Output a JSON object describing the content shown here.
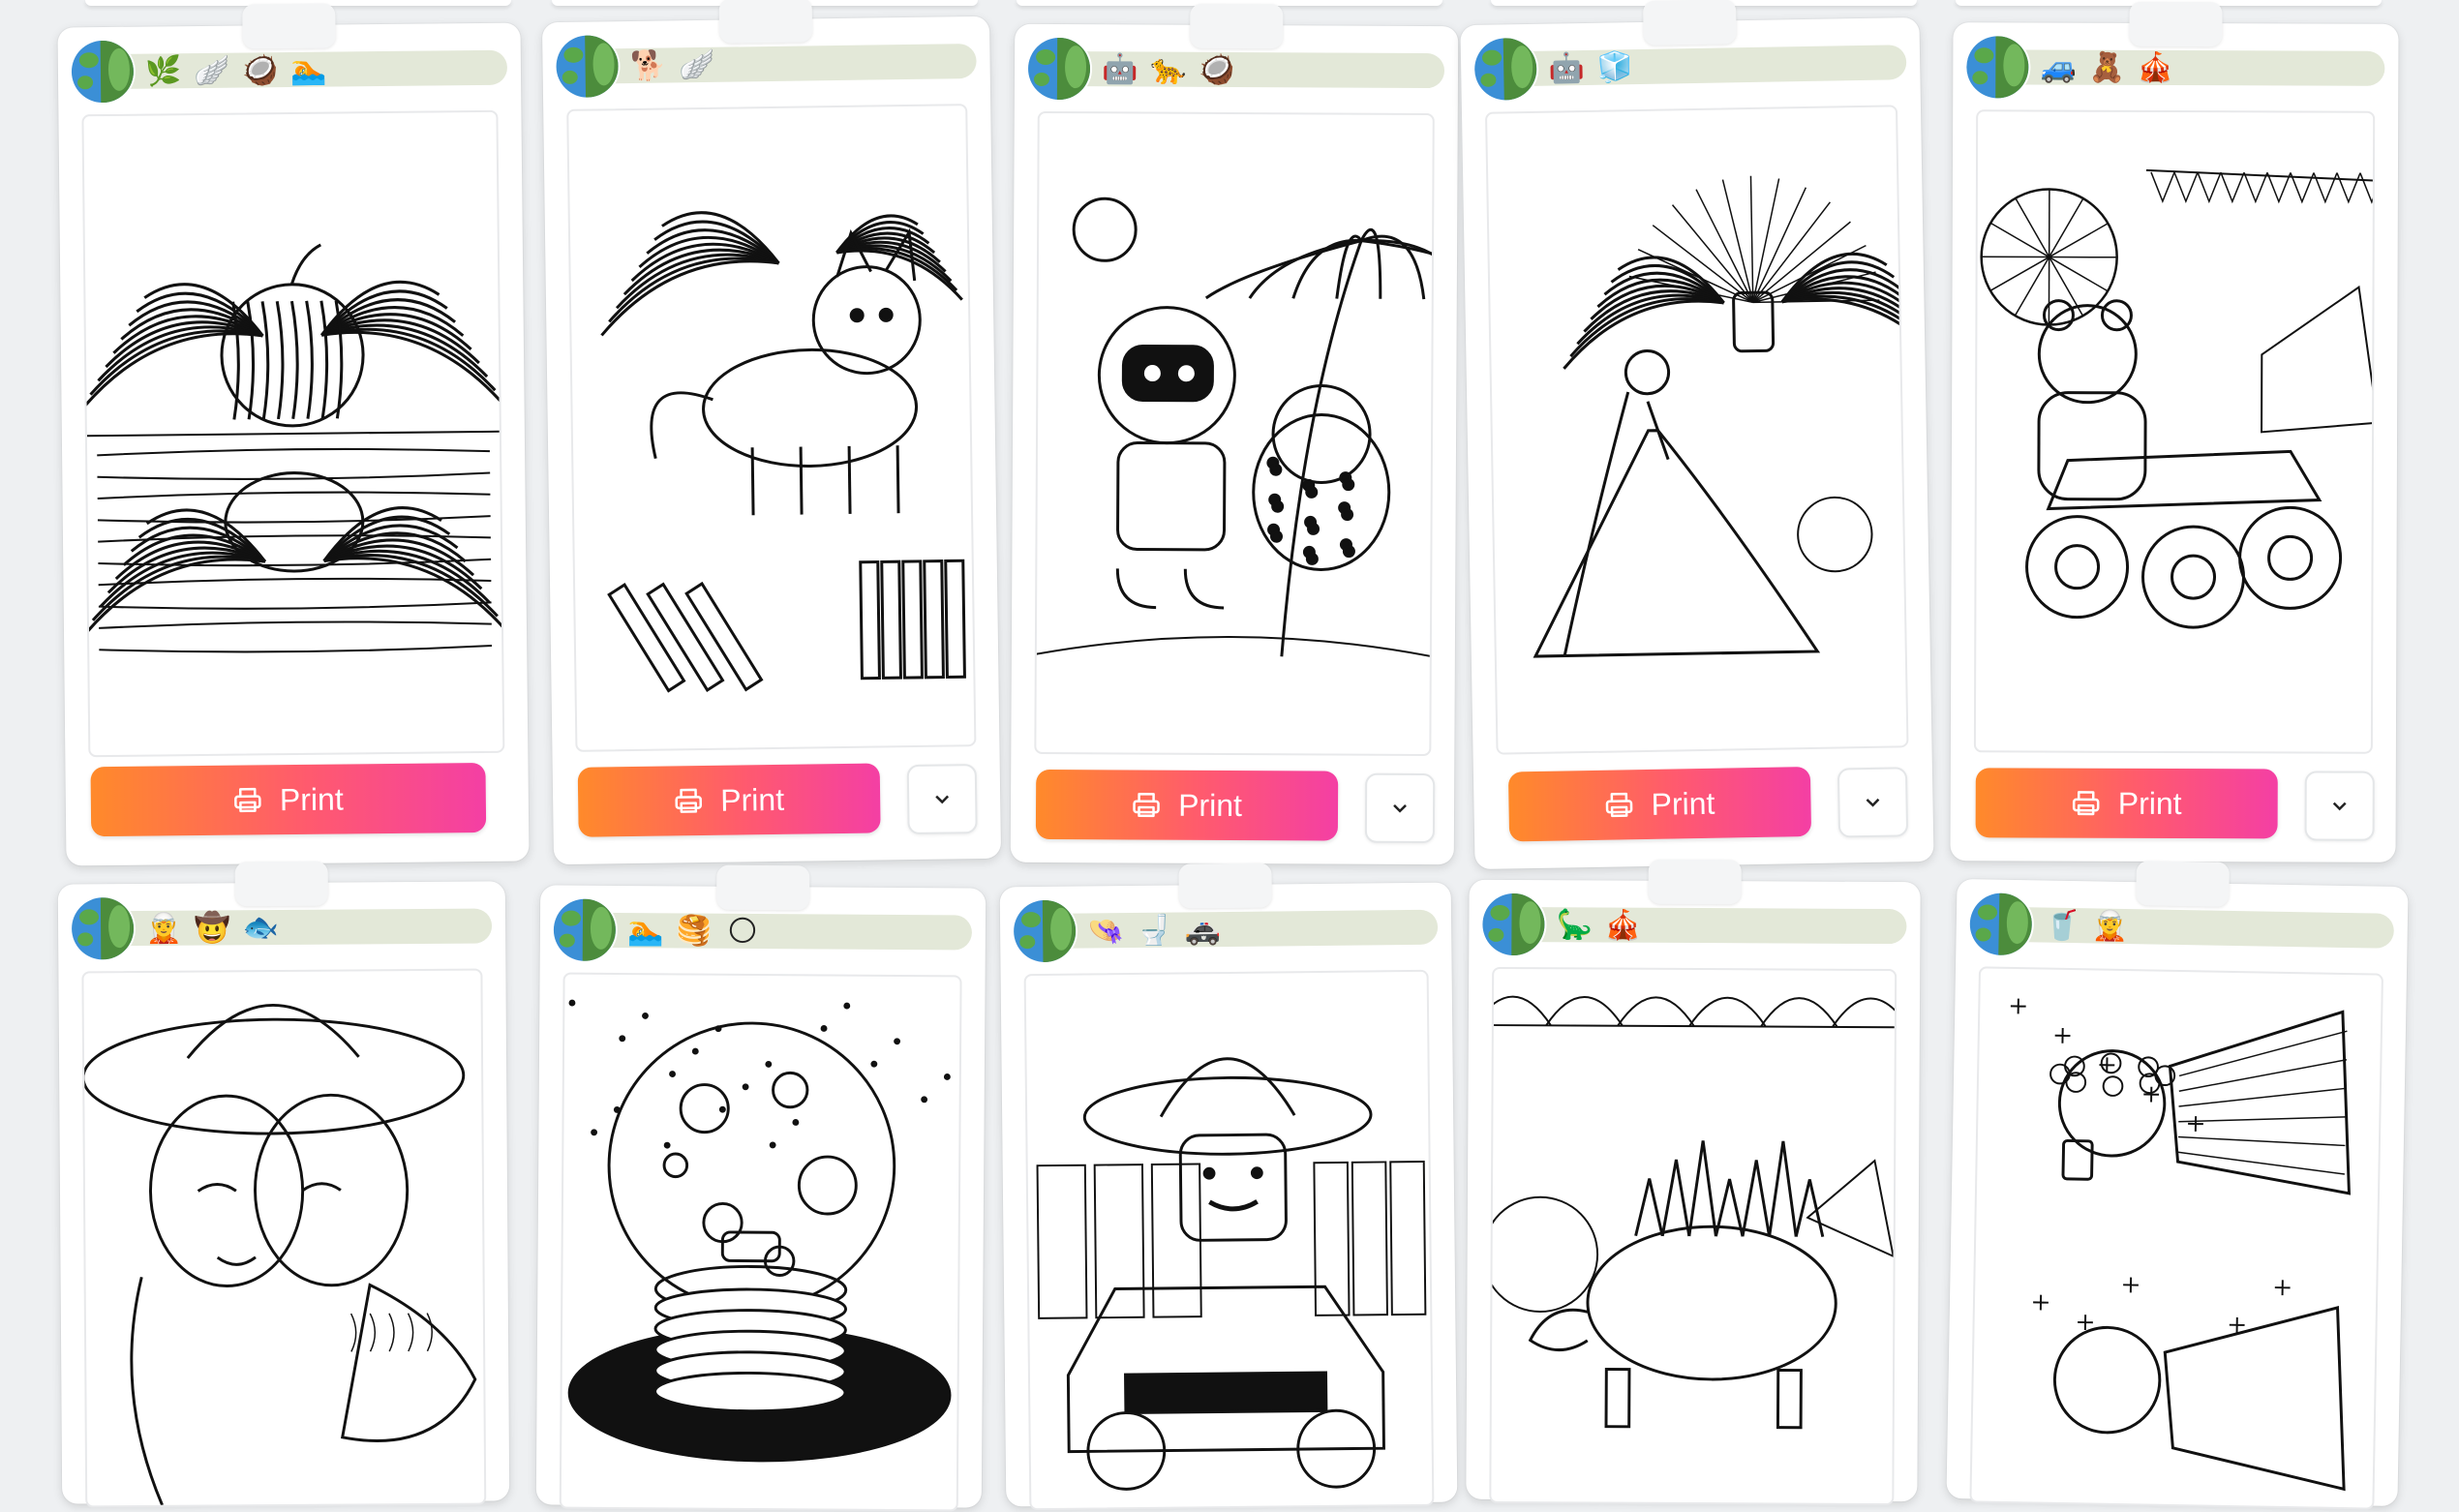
{
  "cards": [
    {
      "emojis": [
        "🌿",
        "🪽",
        "🥥",
        "🏊"
      ],
      "print_label": "Print",
      "has_dropdown": false,
      "art": "winged coconut reflecting on water"
    },
    {
      "emojis": [
        "🐕",
        "🪽"
      ],
      "print_label": "Print",
      "has_dropdown": true,
      "art": "winged puppy with crayons"
    },
    {
      "emojis": [
        "🤖",
        "🐆",
        "🥥"
      ],
      "print_label": "Print",
      "has_dropdown": true,
      "art": "robot and leopard under palm tree"
    },
    {
      "emojis": [
        "🤖",
        "🧊"
      ],
      "print_label": "Print",
      "has_dropdown": true,
      "art": "winged princess and robot"
    },
    {
      "emojis": [
        "🚙",
        "🧸",
        "🎪"
      ],
      "print_label": "Print",
      "has_dropdown": true,
      "art": "teddy bear monster truck carnival"
    },
    {
      "emojis": [
        "🧝",
        "🤠",
        "🐟"
      ],
      "print_label": "Print",
      "has_dropdown": false,
      "art": "cowboy portrait with fish"
    },
    {
      "emojis": [
        "🏊",
        "🥞",
        "🌕"
      ],
      "print_label": "Print",
      "has_dropdown": false,
      "art": "pancakes on moon"
    },
    {
      "emojis": [
        "👒",
        "🚽",
        "🚓"
      ],
      "print_label": "Print",
      "has_dropdown": false,
      "art": "sombrero character in police car"
    },
    {
      "emojis": [
        "🦕",
        "🎪"
      ],
      "print_label": "Print",
      "has_dropdown": false,
      "art": "stegosaurus at carnival"
    },
    {
      "emojis": [
        "🥤",
        "🧝"
      ],
      "print_label": "Print",
      "has_dropdown": false,
      "art": "flower girl with drink"
    }
  ],
  "colors": {
    "print_start": "#ff8a2a",
    "print_end": "#f43fa4",
    "header_bar": "#e3e8d8"
  }
}
